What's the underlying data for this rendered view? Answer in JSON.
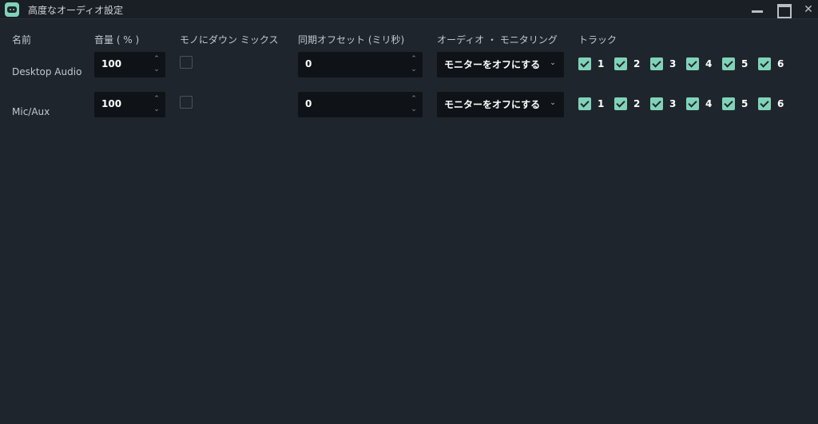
{
  "window": {
    "title": "高度なオーディオ設定",
    "close_glyph": "✕"
  },
  "headers": {
    "name": "名前",
    "volume": "音量 ( % )",
    "mono": "モノにダウン ミックス",
    "sync_offset": "同期オフセット (ミリ秒)",
    "monitoring": "オーディオ ・ モニタリング",
    "tracks": "トラック"
  },
  "spinner": {
    "up": "⌃",
    "down": "⌄"
  },
  "select_chevron": "⌄",
  "sources": [
    {
      "name": "Desktop Audio",
      "volume": "100",
      "mono": false,
      "sync_offset": "0",
      "monitoring": "モニターをオフにする",
      "tracks": [
        "1",
        "2",
        "3",
        "4",
        "5",
        "6"
      ]
    },
    {
      "name": "Mic/Aux",
      "volume": "100",
      "mono": false,
      "sync_offset": "0",
      "monitoring": "モニターをオフにする",
      "tracks": [
        "1",
        "2",
        "3",
        "4",
        "5",
        "6"
      ]
    }
  ],
  "colors": {
    "background": "#1f252d",
    "field": "#0f1318",
    "accent": "#80d3b8"
  }
}
